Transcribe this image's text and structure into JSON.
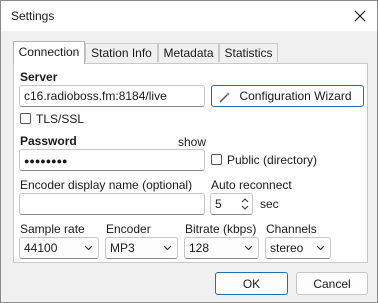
{
  "window": {
    "title": "Settings"
  },
  "tabs": [
    {
      "label": "Connection",
      "active": true
    },
    {
      "label": "Station Info",
      "active": false
    },
    {
      "label": "Metadata",
      "active": false
    },
    {
      "label": "Statistics",
      "active": false
    }
  ],
  "connection": {
    "server_label": "Server",
    "server_value": "c16.radioboss.fm:8184/live",
    "wizard_button": "Configuration Wizard",
    "tls_label": "TLS/SSL",
    "tls_checked": false,
    "password_label": "Password",
    "show_link": "show",
    "password_value": "●●●●●●●●",
    "public_label": "Public (directory)",
    "public_checked": false,
    "encoder_name_label": "Encoder display name (optional)",
    "encoder_name_value": "",
    "auto_reconnect_label": "Auto reconnect",
    "auto_reconnect_value": "5",
    "auto_reconnect_unit": "sec",
    "sample_rate_label": "Sample rate",
    "sample_rate_value": "44100",
    "encoder_label": "Encoder",
    "encoder_value": "MP3",
    "bitrate_label": "Bitrate (kbps)",
    "bitrate_value": "128",
    "channels_label": "Channels",
    "channels_value": "stereo"
  },
  "footer": {
    "ok_label": "OK",
    "cancel_label": "Cancel"
  },
  "colors": {
    "accent": "#1f6fb8",
    "window_bg": "#f0f0f0",
    "panel_bg": "#ffffff"
  },
  "icons": {
    "close": "close-icon",
    "wizard": "magic-wand-icon",
    "dropdown": "chevron-down-icon",
    "spinner": "spinner-arrows-icon"
  }
}
